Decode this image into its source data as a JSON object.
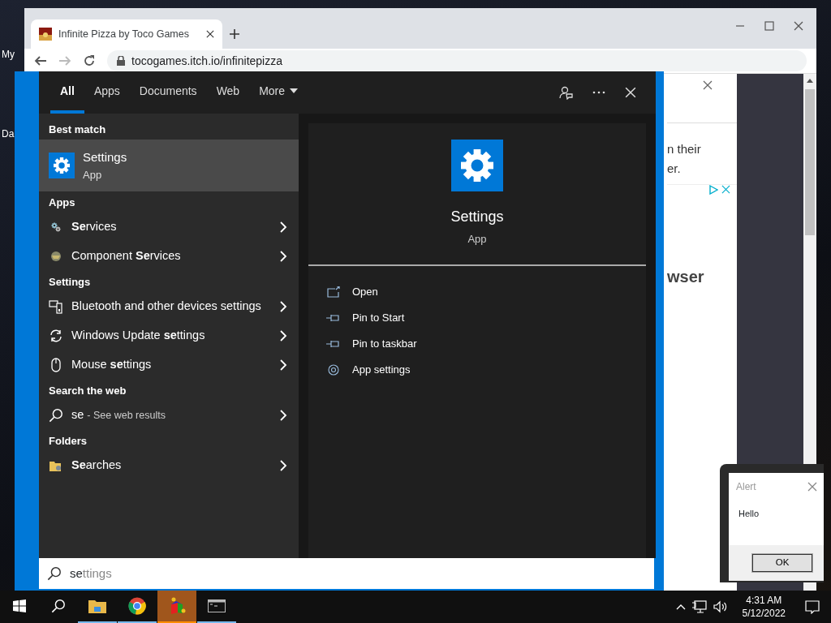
{
  "desktop": {
    "icon_labels": [
      {
        "label": "My"
      },
      {
        "label": "Da"
      }
    ]
  },
  "browser": {
    "tab_title": "Infinite Pizza by Toco Games",
    "url": "tocogames.itch.io/infinitepizza",
    "page_lines": [
      "n their",
      "er."
    ],
    "page_heading": "wser"
  },
  "search": {
    "tabs": [
      {
        "label": "All",
        "selected": true
      },
      {
        "label": "Apps",
        "selected": false
      },
      {
        "label": "Documents",
        "selected": false
      },
      {
        "label": "Web",
        "selected": false
      },
      {
        "label": "More",
        "selected": false
      }
    ],
    "groups": [
      {
        "heading": "Best match",
        "items": [
          {
            "kind": "best",
            "title": "Settings",
            "subtitle": "App",
            "selected": true
          }
        ]
      },
      {
        "heading": "Apps",
        "items": [
          {
            "kind": "result",
            "title": "**Se**rvices",
            "selected": false
          },
          {
            "kind": "result",
            "title": "Component **Se**rvices",
            "selected": false
          }
        ]
      },
      {
        "heading": "Settings",
        "items": [
          {
            "kind": "result",
            "title": "Bluetooth and other devices settings",
            "selected": false
          },
          {
            "kind": "result",
            "title": "Windows Update **se**ttings",
            "selected": false
          },
          {
            "kind": "result",
            "title": "Mouse **se**ttings",
            "selected": false
          }
        ]
      },
      {
        "heading": "Search the web",
        "items": [
          {
            "kind": "web",
            "title": "se",
            "subtitle": "- See web results",
            "selected": false
          }
        ]
      },
      {
        "heading": "Folders",
        "items": [
          {
            "kind": "result",
            "title": "**Se**arches",
            "selected": false
          }
        ]
      }
    ],
    "preview": {
      "title": "Settings",
      "subtitle": "App",
      "actions": [
        "Open",
        "Pin to Start",
        "Pin to taskbar",
        "App settings"
      ]
    },
    "query": {
      "typed": "se",
      "suggestion": "ttings"
    }
  },
  "alert": {
    "title": "Alert",
    "message": "Hello",
    "button": "OK"
  },
  "taskbar": {
    "apps": [
      {
        "running": true,
        "active": false
      },
      {
        "running": true,
        "active": false
      },
      {
        "running": true,
        "active": true
      },
      {
        "running": true,
        "active": false
      }
    ],
    "time": "4:31 AM",
    "date": "5/12/2022"
  }
}
